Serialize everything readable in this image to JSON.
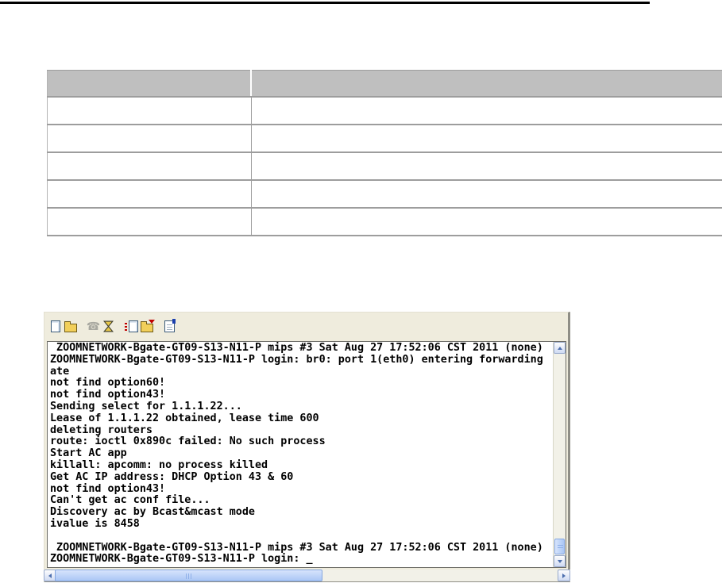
{
  "colors": {
    "table_header_bg": "#bfbfbf",
    "table_line": "#9d9d9d",
    "toolbar_bg": "#efecdd",
    "scrollbar_thumb": "#aac6f5",
    "terminal_text": "#000000",
    "top_rule": "#000000"
  },
  "table": {
    "columns": [
      "",
      ""
    ],
    "rows": [
      [
        "",
        ""
      ],
      [
        "",
        ""
      ],
      [
        "",
        ""
      ],
      [
        "",
        ""
      ],
      [
        "",
        ""
      ]
    ]
  },
  "terminal_window": {
    "toolbar_icons": [
      "new-connection",
      "open",
      "call",
      "hangup",
      "send",
      "receive",
      "properties"
    ],
    "phone_glyph": "☎",
    "lines": [
      " ZOOMNETWORK-Bgate-GT09-S13-N11-P mips #3 Sat Aug 27 17:52:06 CST 2011 (none)",
      "ZOOMNETWORK-Bgate-GT09-S13-N11-P login: br0: port 1(eth0) entering forwarding",
      "ate",
      "not find option60!",
      "not find option43!",
      "Sending select for 1.1.1.22...",
      "Lease of 1.1.1.22 obtained, lease time 600",
      "deleting routers",
      "route: ioctl 0x890c failed: No such process",
      "Start AC app",
      "killall: apcomm: no process killed",
      "Get AC IP address: DHCP Option 43 & 60",
      "not find option43!",
      "Can't get ac conf file...",
      "Discovery ac by Bcast&mcast mode",
      "ivalue is 8458",
      "",
      " ZOOMNETWORK-Bgate-GT09-S13-N11-P mips #3 Sat Aug 27 17:52:06 CST 2011 (none)",
      "ZOOMNETWORK-Bgate-GT09-S13-N11-P login: _"
    ]
  }
}
